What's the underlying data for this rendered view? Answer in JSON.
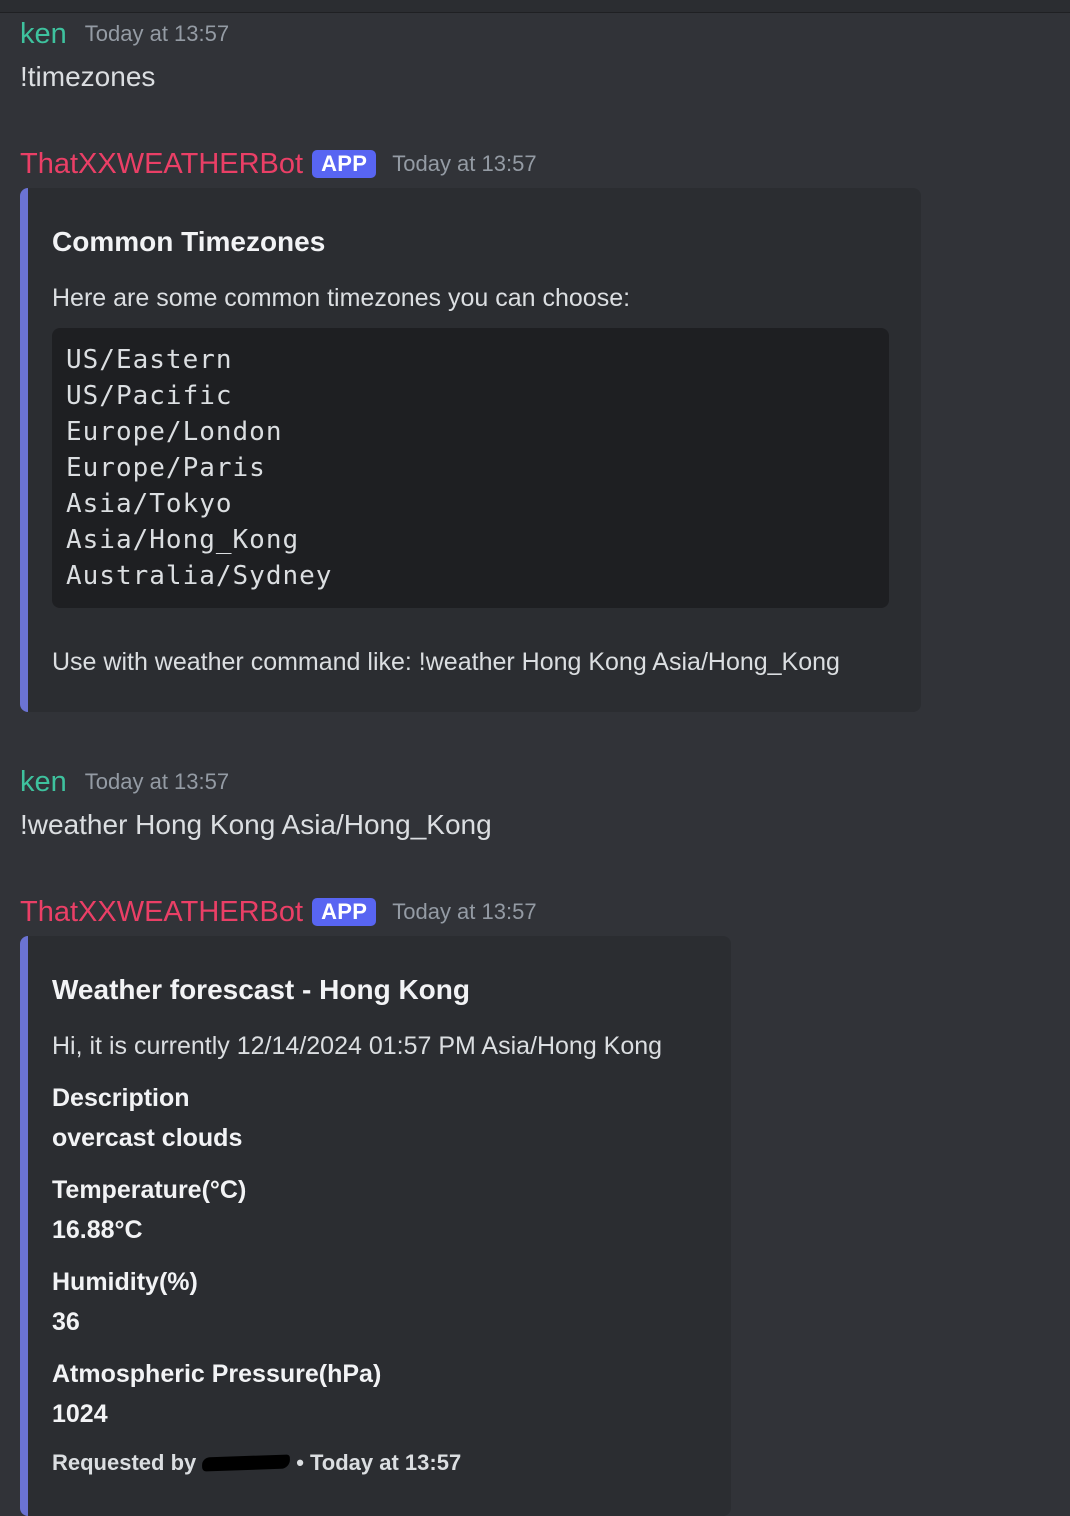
{
  "messages": [
    {
      "author": "ken",
      "timestamp": "Today at 13:57",
      "text": "!timezones"
    },
    {
      "author": "ThatXXWEATHERBot",
      "badge": "APP",
      "timestamp": "Today at 13:57",
      "embed": {
        "title": "Common Timezones",
        "description": "Here are some common timezones you can choose:",
        "code_lines": [
          "US/Eastern",
          "US/Pacific",
          "Europe/London",
          "Europe/Paris",
          "Asia/Tokyo",
          "Asia/Hong_Kong",
          "Australia/Sydney"
        ],
        "note": "Use with weather command like: !weather Hong Kong Asia/Hong_Kong"
      }
    },
    {
      "author": "ken",
      "timestamp": "Today at 13:57",
      "text": "!weather Hong Kong Asia/Hong_Kong"
    },
    {
      "author": "ThatXXWEATHERBot",
      "badge": "APP",
      "timestamp": "Today at 13:57",
      "embed": {
        "title": "Weather forescast - Hong Kong",
        "description": "Hi, it is currently 12/14/2024 01:57 PM Asia/Hong Kong",
        "fields": [
          {
            "name": "Description",
            "value": "overcast clouds"
          },
          {
            "name": "Temperature(°C)",
            "value": "16.88°C"
          },
          {
            "name": "Humidity(%)",
            "value": "36"
          },
          {
            "name": "Atmospheric Pressure(hPa)",
            "value": "1024"
          }
        ],
        "footer": {
          "requested_by_label": "Requested by",
          "separator": "•",
          "timestamp": "Today at 13:57"
        }
      }
    }
  ],
  "colors": {
    "background": "#313338",
    "embed_background": "#2b2d31",
    "embed_accent": "#6b73d3",
    "user_color": "#3ec29e",
    "bot_color": "#ea3f66",
    "app_badge": "#5865f2"
  }
}
